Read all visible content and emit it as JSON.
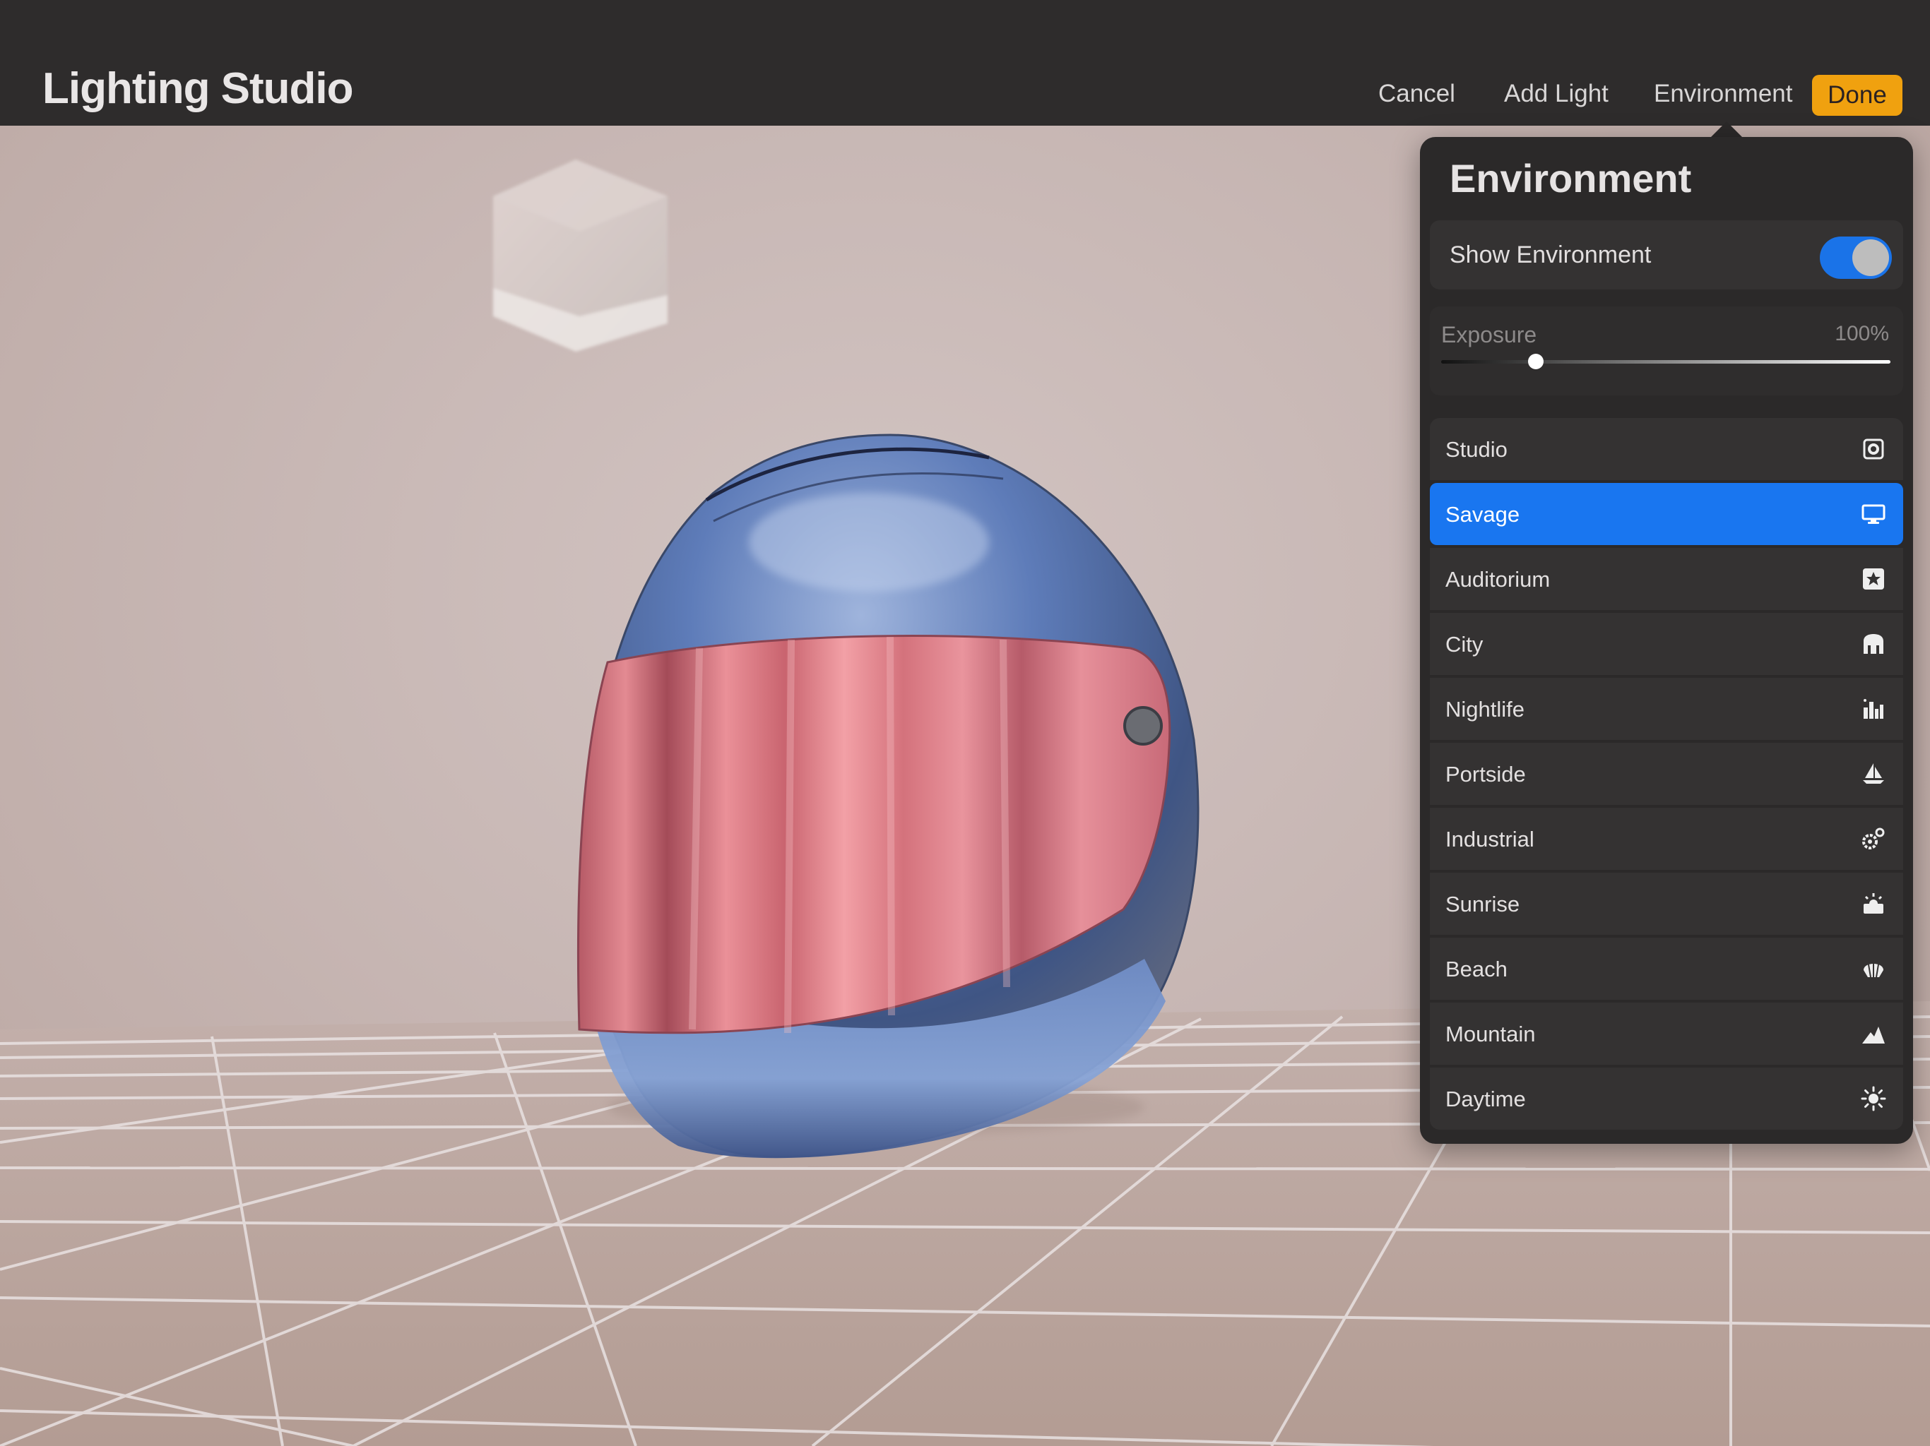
{
  "app": {
    "title": "Lighting Studio"
  },
  "toolbar": {
    "cancel_label": "Cancel",
    "add_light_label": "Add Light",
    "environment_label": "Environment",
    "done_label": "Done"
  },
  "environment_panel": {
    "title": "Environment",
    "show_environment_label": "Show Environment",
    "show_environment_on": true,
    "exposure_label": "Exposure",
    "exposure_value": "100%",
    "exposure_slider_fraction": 0.21,
    "items": [
      {
        "label": "Studio",
        "icon": "studio-light-icon",
        "selected": false
      },
      {
        "label": "Savage",
        "icon": "monitor-icon",
        "selected": true
      },
      {
        "label": "Auditorium",
        "icon": "star-icon",
        "selected": false
      },
      {
        "label": "City",
        "icon": "city-icon",
        "selected": false
      },
      {
        "label": "Nightlife",
        "icon": "nightlife-icon",
        "selected": false
      },
      {
        "label": "Portside",
        "icon": "sailboat-icon",
        "selected": false
      },
      {
        "label": "Industrial",
        "icon": "gears-icon",
        "selected": false
      },
      {
        "label": "Sunrise",
        "icon": "sunrise-icon",
        "selected": false
      },
      {
        "label": "Beach",
        "icon": "shell-icon",
        "selected": false
      },
      {
        "label": "Mountain",
        "icon": "mountain-icon",
        "selected": false
      },
      {
        "label": "Daytime",
        "icon": "sun-icon",
        "selected": false
      }
    ]
  },
  "colors": {
    "accent_blue": "#1976f0",
    "done_orange": "#f0a10f",
    "topbar_bg": "#2e2c2c",
    "panel_bg": "#2b2929",
    "visor_pink": "#e07b84",
    "helmet_blue": "#5a79b8"
  }
}
